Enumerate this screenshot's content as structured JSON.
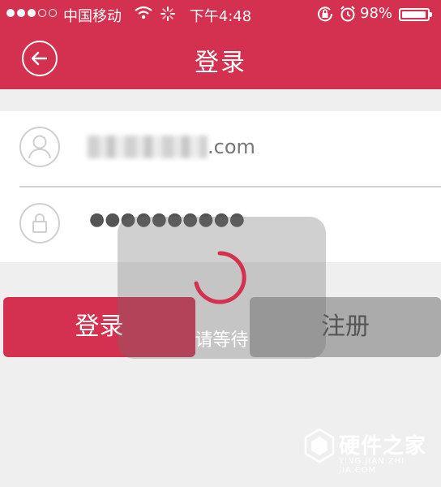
{
  "status_bar": {
    "carrier": "中国移动",
    "time": "下午4:48",
    "battery_percent": "98%",
    "battery_level": 0.98
  },
  "nav": {
    "title": "登录"
  },
  "form": {
    "email_suffix": ".com",
    "password_mask": "●●●●●●●●●●"
  },
  "buttons": {
    "login": "登录",
    "register": "注册"
  },
  "loading": {
    "text": "请等待"
  },
  "watermark": {
    "name": "硬件之家",
    "pinyin": "YING JIAN ZHI JIA.COM"
  },
  "colors": {
    "accent": "#d4304f",
    "background": "#efefef"
  }
}
